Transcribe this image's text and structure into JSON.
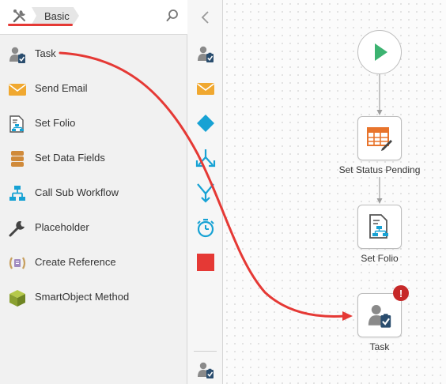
{
  "toolbox": {
    "breadcrumb": {
      "tools_icon": "tools-icon",
      "current": "Basic"
    },
    "search_icon": "search-icon",
    "items": [
      {
        "label": "Task",
        "icon": "task-icon"
      },
      {
        "label": "Send Email",
        "icon": "email-icon"
      },
      {
        "label": "Set Folio",
        "icon": "folio-icon"
      },
      {
        "label": "Set Data Fields",
        "icon": "data-fields-icon"
      },
      {
        "label": "Call Sub Workflow",
        "icon": "sub-workflow-icon"
      },
      {
        "label": "Placeholder",
        "icon": "wrench-icon"
      },
      {
        "label": "Create Reference",
        "icon": "reference-icon"
      },
      {
        "label": "SmartObject Method",
        "icon": "smartobject-icon"
      }
    ]
  },
  "rail": {
    "collapse_icon": "chevron-left-icon",
    "items": [
      "task-icon",
      "email-icon",
      "decision-icon",
      "split-icon",
      "merge-icon",
      "timer-icon",
      "end-icon"
    ],
    "footer_icon": "task-icon"
  },
  "canvas": {
    "start": {
      "icon": "play-icon"
    },
    "nodes": [
      {
        "label": "Set Status Pending",
        "icon": "set-data-fields-icon"
      },
      {
        "label": "Set Folio",
        "icon": "folio-icon"
      },
      {
        "label": "Task",
        "icon": "task-icon",
        "error_badge": "!"
      }
    ]
  },
  "colors": {
    "accent_red": "#e53935",
    "start_green": "#3cb371",
    "email_orange": "#f0a830",
    "teal": "#17a2d4",
    "data_fields_brown": "#d08a3a",
    "end_red": "#e53935",
    "error_red": "#c62828"
  }
}
